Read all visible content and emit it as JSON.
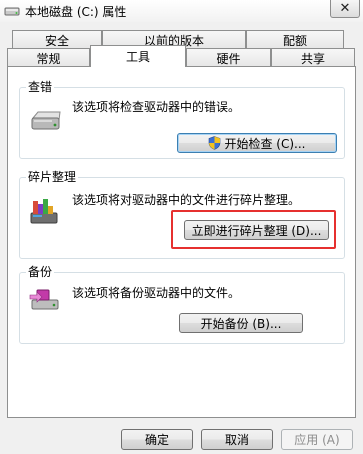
{
  "window": {
    "title": "本地磁盘 (C:) 属性",
    "close_glyph": "✕"
  },
  "tabs": {
    "row_top": [
      "安全",
      "以前的版本",
      "配额"
    ],
    "row_bottom": [
      "常规",
      "工具",
      "硬件",
      "共享"
    ],
    "active": "工具"
  },
  "error_check": {
    "group_label": "查错",
    "description": "该选项将检查驱动器中的错误。",
    "button_label": "开始检查 (C)..."
  },
  "defrag": {
    "group_label": "碎片整理",
    "description": "该选项将对驱动器中的文件进行碎片整理。",
    "button_label": "立即进行碎片整理 (D)..."
  },
  "backup": {
    "group_label": "备份",
    "description": "该选项将备份驱动器中的文件。",
    "button_label": "开始备份 (B)..."
  },
  "footer": {
    "ok_label": "确定",
    "cancel_label": "取消",
    "apply_label": "应用 (A)"
  },
  "icons": {
    "title": "drive-icon",
    "error_check": "hard-drive-icon",
    "defrag": "defrag-icon",
    "backup": "backup-icon",
    "shield": "uac-shield-icon"
  },
  "colors": {
    "highlight": "#e6302f",
    "panel_bg": "#ffffff",
    "window_bg": "#f0f0f0"
  }
}
